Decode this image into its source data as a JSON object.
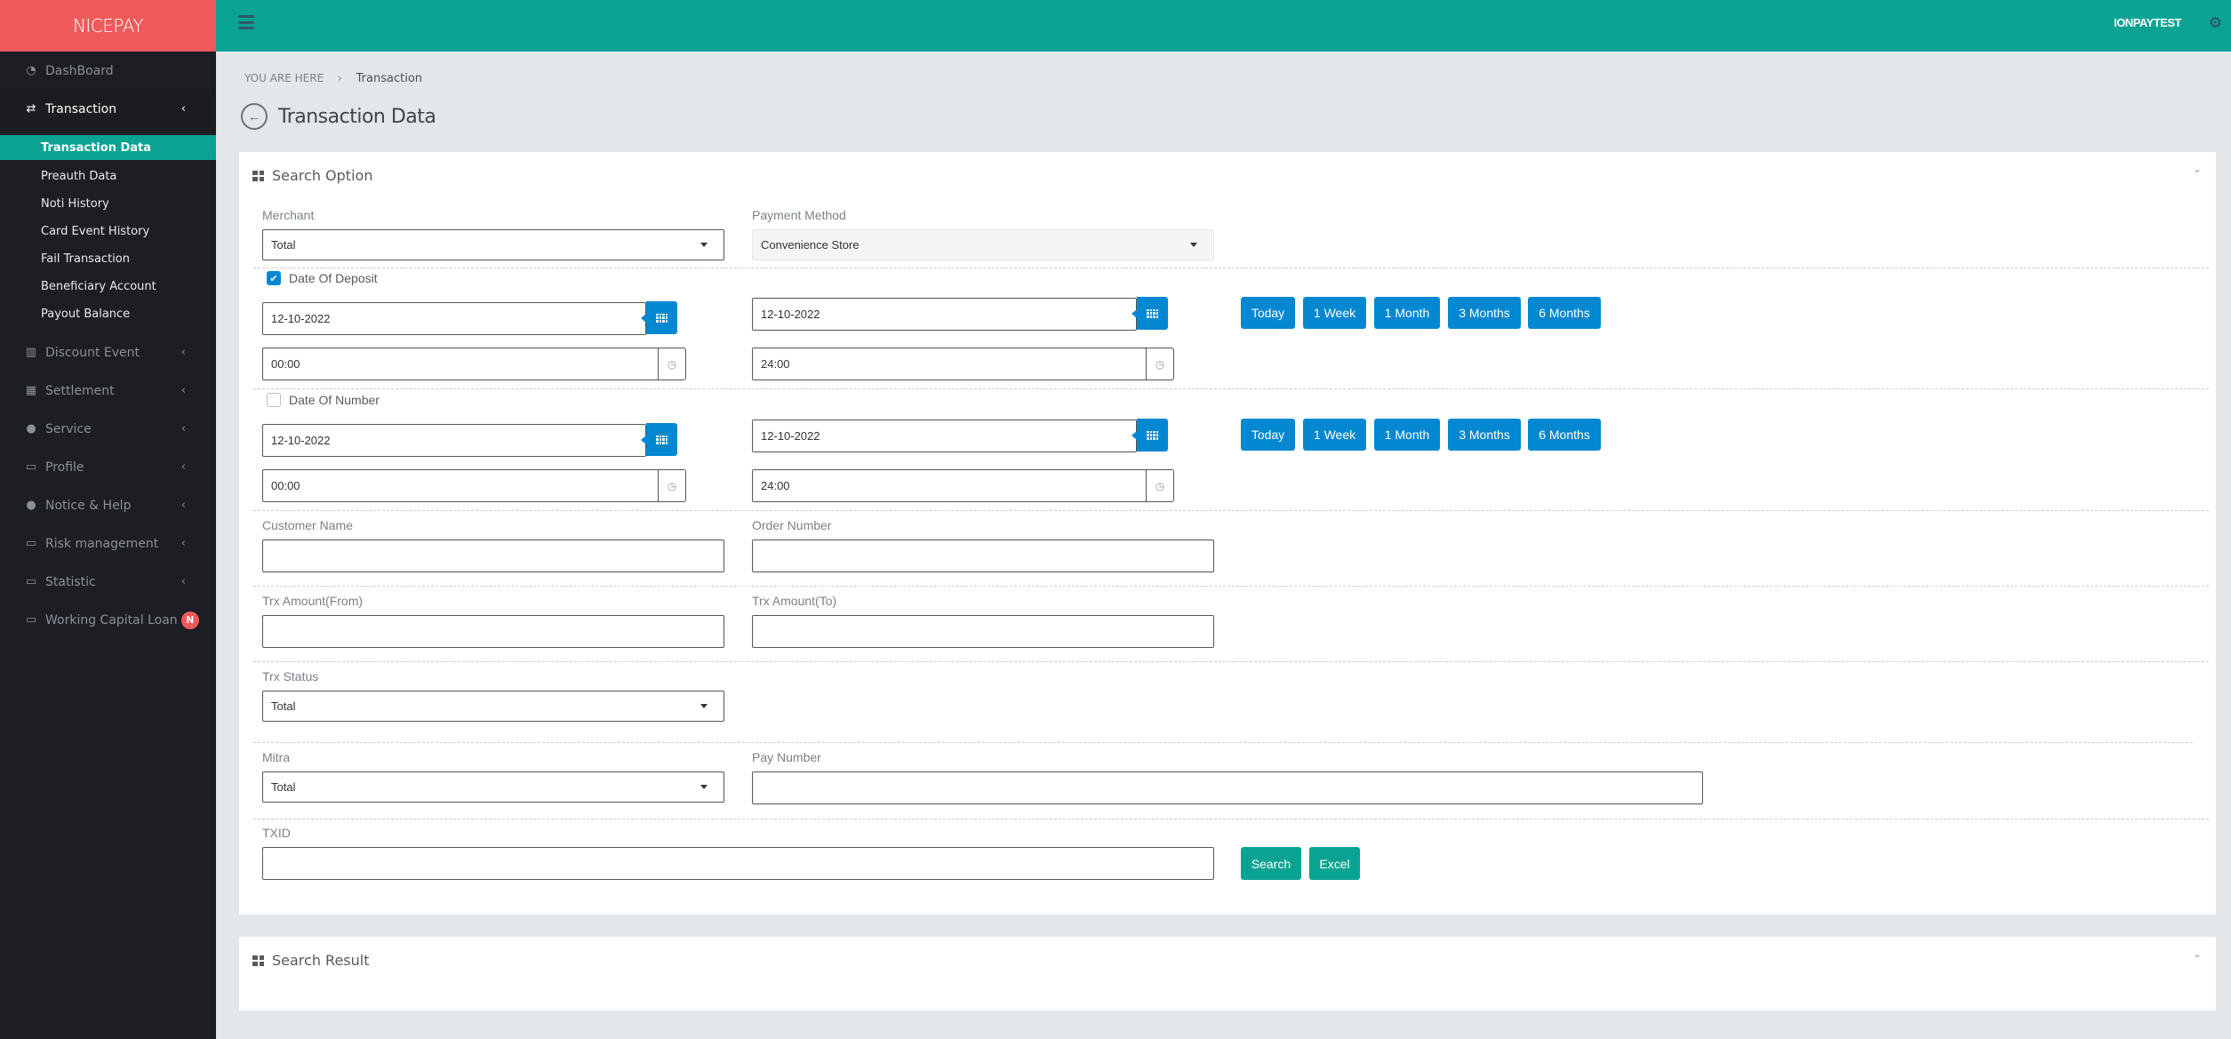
{
  "brand": "NICEPAY",
  "sidebar": {
    "items": [
      {
        "label": "DashBoard",
        "icon": "dashboard-icon"
      },
      {
        "label": "Transaction",
        "icon": "exchange-icon"
      },
      {
        "label": "Discount Event",
        "icon": "bar-chart-icon"
      },
      {
        "label": "Settlement",
        "icon": "calendar-icon"
      },
      {
        "label": "Service",
        "icon": "users-icon"
      },
      {
        "label": "Profile",
        "icon": "desktop-icon"
      },
      {
        "label": "Notice & Help",
        "icon": "comment-icon"
      },
      {
        "label": "Risk management",
        "icon": "folder-icon"
      },
      {
        "label": "Statistic",
        "icon": "folder-icon"
      },
      {
        "label": "Working Capital Loan",
        "icon": "folder-icon",
        "badge": "N"
      }
    ],
    "transaction_sub": [
      {
        "label": "Transaction Data",
        "active": true
      },
      {
        "label": "Preauth Data"
      },
      {
        "label": "Noti History"
      },
      {
        "label": "Card Event History"
      },
      {
        "label": "Fail Transaction"
      },
      {
        "label": "Beneficiary Account"
      },
      {
        "label": "Payout Balance"
      }
    ]
  },
  "header": {
    "user": "IONPAYTEST"
  },
  "breadcrumb": {
    "prefix": "YOU ARE HERE",
    "separator": "›",
    "current": "Transaction"
  },
  "page_title": "Transaction Data",
  "search_panel": {
    "title": "Search Option",
    "merchant": {
      "label": "Merchant",
      "value": "Total"
    },
    "payment_method": {
      "label": "Payment Method",
      "value": "Convenience Store"
    },
    "date_of_deposit": {
      "label": "Date Of Deposit",
      "checked": true,
      "from_date": "12-10-2022",
      "to_date": "12-10-2022",
      "from_time": "00:00",
      "to_time": "24:00"
    },
    "date_of_number": {
      "label": "Date Of Number",
      "checked": false,
      "from_date": "12-10-2022",
      "to_date": "12-10-2022",
      "from_time": "00:00",
      "to_time": "24:00"
    },
    "quick_ranges": [
      "Today",
      "1 Week",
      "1 Month",
      "3 Months",
      "6 Months"
    ],
    "customer_name": {
      "label": "Customer Name",
      "value": ""
    },
    "order_number": {
      "label": "Order Number",
      "value": ""
    },
    "trx_amount_from": {
      "label": "Trx Amount(From)",
      "value": ""
    },
    "trx_amount_to": {
      "label": "Trx Amount(To)",
      "value": ""
    },
    "trx_status": {
      "label": "Trx Status",
      "value": "Total"
    },
    "mitra": {
      "label": "Mitra",
      "value": "Total"
    },
    "pay_number": {
      "label": "Pay Number",
      "value": ""
    },
    "txid": {
      "label": "TXID",
      "value": ""
    },
    "search_label": "Search",
    "excel_label": "Excel"
  },
  "result_panel": {
    "title": "Search Result"
  },
  "colors": {
    "brand": "#f05a5b",
    "header": "#0aa393",
    "sidebar": "#1c1e23",
    "primary_button": "#0288d1",
    "action_button": "#0aa393"
  }
}
